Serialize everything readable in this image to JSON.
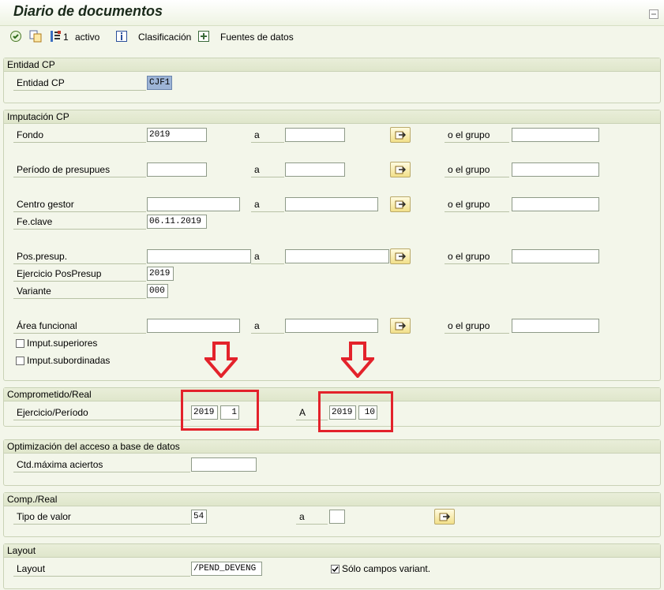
{
  "window": {
    "title": "Diario de documentos"
  },
  "toolbar": {
    "active_count": "1",
    "active_label": "activo",
    "classification_label": "Clasificación",
    "datasources_label": "Fuentes de datos"
  },
  "groups": {
    "entidad": {
      "title": "Entidad CP",
      "label": "Entidad CP",
      "value": "CJF1"
    },
    "imputacion": {
      "title": "Imputación CP",
      "to_label": "a",
      "group_label": "o el grupo",
      "fondo": {
        "label": "Fondo",
        "value": "2019"
      },
      "periodo": {
        "label": "Período de presupues"
      },
      "centro": {
        "label": "Centro gestor"
      },
      "fecha": {
        "label": "Fe.clave",
        "value": "06.11.2019"
      },
      "pospresup": {
        "label": "Pos.presup."
      },
      "ejercicio": {
        "label": "Ejercicio PosPresup",
        "value": "2019"
      },
      "variante": {
        "label": "Variante",
        "value": "000"
      },
      "area": {
        "label": "Área funcional"
      },
      "imput_sup": "Imput.superiores",
      "imput_sub": "Imput.subordinadas"
    },
    "comprometido": {
      "title": "Comprometido/Real",
      "label": "Ejercicio/Período",
      "from_year": "2019",
      "from_period": "1",
      "to_label": "A",
      "to_year": "2019",
      "to_period": "10"
    },
    "optimizacion": {
      "title": "Optimización del acceso a base de datos",
      "label": "Ctd.máxima aciertos"
    },
    "compreal": {
      "title": "Comp./Real",
      "label": "Tipo de valor",
      "value": "54",
      "to_label": "a"
    },
    "layout": {
      "title": "Layout",
      "label": "Layout",
      "value": "/PEND_DEVENG",
      "only_variant_label": "Sólo campos variant."
    }
  },
  "colors": {
    "background": "#f3f6ea",
    "highlight_red": "#e3222b",
    "selected_field": "#9db4d6",
    "button_yellow": "#f2e08a"
  }
}
